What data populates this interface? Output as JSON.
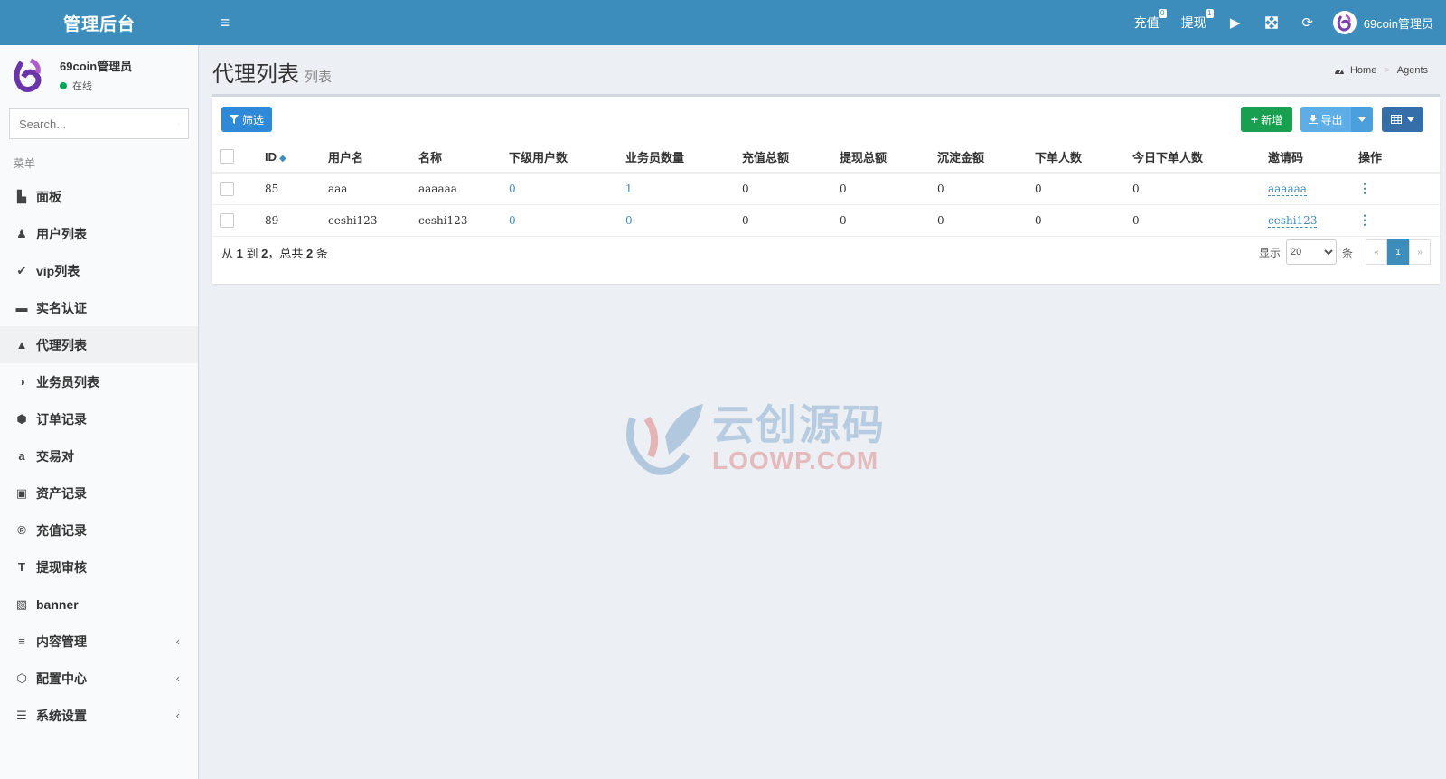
{
  "header": {
    "logo": "管理后台",
    "hamburger": "≡",
    "recharge_label": "充值",
    "recharge_badge": "0",
    "withdraw_label": "提现",
    "withdraw_badge": "1",
    "play_icon": "▶",
    "fullscreen_icon": "⤧",
    "refresh_icon": "⟳",
    "user_name": "69coin管理员"
  },
  "sidebar": {
    "user_name": "69coin管理员",
    "user_status": "在线",
    "search_placeholder": "Search...",
    "menu_header": "菜单",
    "items": [
      {
        "label": "面板",
        "icon": "▙"
      },
      {
        "label": "用户列表",
        "icon": "♟"
      },
      {
        "label": "vip列表",
        "icon": "✔"
      },
      {
        "label": "实名认证",
        "icon": "▬"
      },
      {
        "label": "代理列表",
        "icon": "▲"
      },
      {
        "label": "业务员列表",
        "icon": "◑"
      },
      {
        "label": "订单记录",
        "icon": "⬢"
      },
      {
        "label": "交易对",
        "icon": "a"
      },
      {
        "label": "资产记录",
        "icon": "▣"
      },
      {
        "label": "充值记录",
        "icon": "®"
      },
      {
        "label": "提现审核",
        "icon": "T"
      },
      {
        "label": "banner",
        "icon": "▧"
      },
      {
        "label": "内容管理",
        "icon": "≡"
      },
      {
        "label": "配置中心",
        "icon": "⬡"
      },
      {
        "label": "系统设置",
        "icon": "☰"
      }
    ],
    "caret": "‹"
  },
  "content": {
    "title": "代理列表",
    "subtitle": "列表",
    "breadcrumb_home": "Home",
    "breadcrumb_sep": ">",
    "breadcrumb_current": "Agents"
  },
  "toolbar": {
    "filter_label": "筛选",
    "add_label": "新增",
    "export_label": "导出"
  },
  "table": {
    "headers": [
      "ID",
      "用户名",
      "名称",
      "下级用户数",
      "业务员数量",
      "充值总额",
      "提现总额",
      "沉淀金额",
      "下单人数",
      "今日下单人数",
      "邀请码",
      "操作"
    ],
    "rows": [
      [
        "85",
        "aaa",
        "aaaaaa",
        "0",
        "1",
        "0",
        "0",
        "0",
        "0",
        "0",
        "aaaaaa",
        "⋮"
      ],
      [
        "89",
        "ceshi123",
        "ceshi123",
        "0",
        "0",
        "0",
        "0",
        "0",
        "0",
        "0",
        "ceshi123",
        "⋮"
      ]
    ]
  },
  "footer": {
    "from_label": "从",
    "from": "1",
    "to_label": "到",
    "to": "2",
    "total_label": "，总共",
    "total": "2",
    "unit": "条",
    "show_label": "显示",
    "per_page": "20",
    "per_page_unit": "条",
    "prev": "«",
    "page": "1",
    "next": "»"
  },
  "watermark": {
    "cn": "云创源码",
    "en": "LOOWP.COM"
  }
}
